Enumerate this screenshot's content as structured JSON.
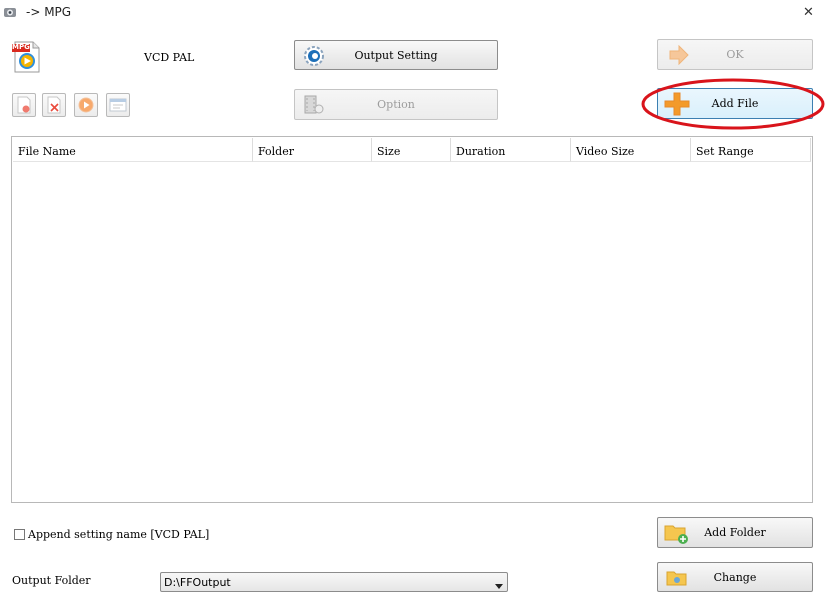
{
  "window": {
    "title": "-> MPG",
    "close_glyph": "✕"
  },
  "profile": {
    "format_label": "VCD PAL",
    "icon_text": "MPG"
  },
  "buttons": {
    "output_setting": "Output Setting",
    "ok": "OK",
    "option": "Option",
    "add_file": "Add File",
    "add_folder": "Add Folder",
    "change": "Change"
  },
  "toolbar": [
    {
      "name": "remove-file-icon"
    },
    {
      "name": "clear-list-icon"
    },
    {
      "name": "play-icon"
    },
    {
      "name": "media-info-icon"
    }
  ],
  "file_list": {
    "columns": [
      "File Name",
      "Folder",
      "Size",
      "Duration",
      "Video Size",
      "Set Range"
    ],
    "rows": []
  },
  "append_setting": {
    "label": "Append setting name [VCD PAL]",
    "checked": false
  },
  "output_folder": {
    "label": "Output Folder",
    "value": "D:\\FFOutput"
  },
  "colors": {
    "highlight_ellipse": "#d9141b",
    "accent_orange": "#f39a2a",
    "accent_blue": "#1f7fd1"
  }
}
